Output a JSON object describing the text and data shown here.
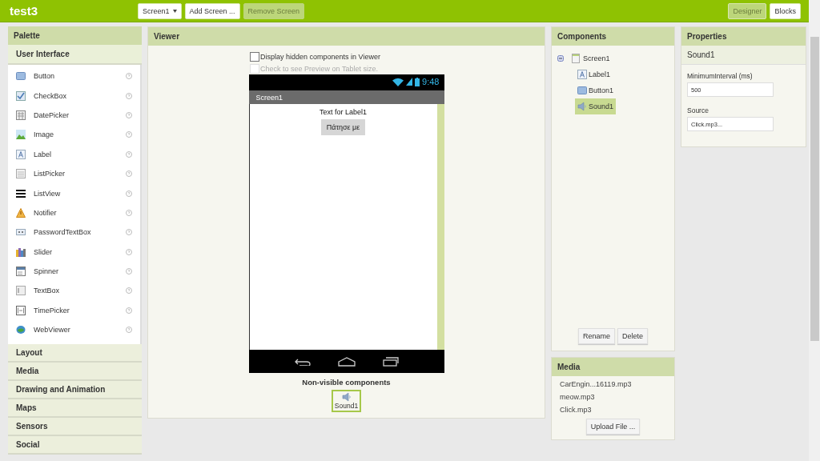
{
  "top_bar": {
    "app_title": "test3",
    "screen_dropdown": "Screen1",
    "buttons": [
      {
        "label": "Add Screen ...",
        "disabled": false
      },
      {
        "label": "Remove Screen",
        "disabled": true
      }
    ],
    "view_buttons": [
      {
        "label": "Designer",
        "selected": true
      },
      {
        "label": "Blocks",
        "selected": false
      }
    ]
  },
  "palette": {
    "title": "Palette",
    "groups": [
      {
        "label": "User Interface",
        "items": [
          {
            "label": "Button",
            "kind": "button"
          },
          {
            "label": "CheckBox",
            "kind": "checkbox"
          },
          {
            "label": "DatePicker",
            "kind": "datepicker"
          },
          {
            "label": "Image",
            "kind": "image"
          },
          {
            "label": "Label",
            "kind": "label"
          },
          {
            "label": "ListPicker",
            "kind": "listpicker"
          },
          {
            "label": "ListView",
            "kind": "listview"
          },
          {
            "label": "Notifier",
            "kind": "notifier"
          },
          {
            "label": "PasswordTextBox",
            "kind": "password"
          },
          {
            "label": "Slider",
            "kind": "slider"
          },
          {
            "label": "Spinner",
            "kind": "spinner"
          },
          {
            "label": "TextBox",
            "kind": "textbox"
          },
          {
            "label": "TimePicker",
            "kind": "timepicker"
          },
          {
            "label": "WebViewer",
            "kind": "webviewer"
          }
        ]
      },
      {
        "label": "Layout"
      },
      {
        "label": "Media"
      },
      {
        "label": "Drawing and Animation"
      },
      {
        "label": "Maps"
      },
      {
        "label": "Sensors"
      },
      {
        "label": "Social"
      }
    ]
  },
  "viewer": {
    "title": "Viewer",
    "options": [
      {
        "label": "Display hidden components in Viewer",
        "checked": false,
        "disabled": false
      },
      {
        "label": "Check to see Preview on Tablet size.",
        "checked": false,
        "disabled": true
      }
    ],
    "phone": {
      "status_time": "9:48",
      "screen_title": "Screen1",
      "label_text": "Text for Label1",
      "button_text": "Πάτησε με"
    },
    "non_visible": {
      "title": "Non-visible components",
      "items": [
        {
          "label": "Sound1",
          "selected": true
        }
      ]
    }
  },
  "components": {
    "title": "Components",
    "tree": {
      "label": "Screen1",
      "kind": "screen",
      "expanded": true,
      "children": [
        {
          "label": "Label1",
          "kind": "label",
          "selected": false
        },
        {
          "label": "Button1",
          "kind": "button",
          "selected": false
        },
        {
          "label": "Sound1",
          "kind": "sound",
          "selected": true
        }
      ]
    },
    "buttons": [
      "Rename",
      "Delete"
    ]
  },
  "media": {
    "title": "Media",
    "files": [
      "CarEngin...16119.mp3",
      "meow.mp3",
      "Click.mp3"
    ],
    "upload_button": "Upload File ..."
  },
  "properties": {
    "title": "Properties",
    "component": "Sound1",
    "fields": [
      {
        "label": "MinimumInterval (ms)",
        "value": "500"
      },
      {
        "label": "Source",
        "value": "Click.mp3..."
      }
    ]
  }
}
